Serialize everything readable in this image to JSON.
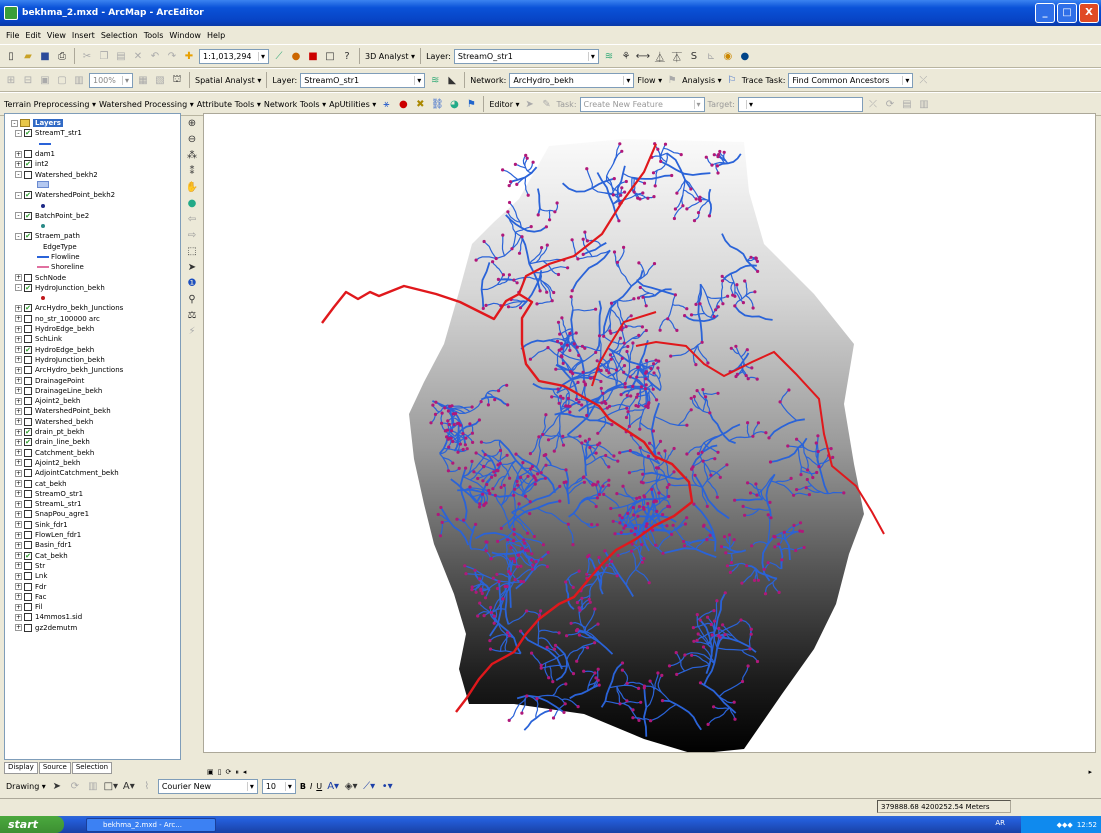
{
  "window": {
    "title": "bekhma_2.mxd - ArcMap - ArcEditor",
    "buttons": [
      "_",
      "□",
      "X"
    ]
  },
  "menu": [
    "File",
    "Edit",
    "View",
    "Insert",
    "Selection",
    "Tools",
    "Window",
    "Help"
  ],
  "standard_tb": {
    "scale": "1:1,013,294",
    "analyst_3d": "3D Analyst ▾",
    "layer_label": "Layer:",
    "layer_value": "StreamO_str1"
  },
  "spatial_tb": {
    "zoom": "100%",
    "spatial_analyst": "Spatial Analyst ▾",
    "layer_label": "Layer:",
    "layer_value": "StreamO_str1",
    "network_label": "Network:",
    "network_value": "ArcHydro_bekh",
    "flow": "Flow ▾",
    "analysis": "Analysis ▾",
    "trace_label": "Trace Task:",
    "trace_value": "Find Common Ancestors"
  },
  "hydro_tb": {
    "items": [
      "Terrain Preprocessing ▾",
      "Watershed Processing ▾",
      "Attribute Tools ▾",
      "Network Tools ▾",
      "ApUtilities ▾"
    ],
    "editor": "Editor ▾",
    "task_label": "Task:",
    "task_value": "Create New Feature",
    "target_label": "Target:"
  },
  "toc": {
    "rows": [
      {
        "type": "group",
        "exp": "-",
        "label": "Layers"
      },
      {
        "type": "layer",
        "exp": "-",
        "checked": true,
        "label": "StreamT_str1"
      },
      {
        "type": "sym",
        "symbol": "line-blue"
      },
      {
        "type": "layer",
        "exp": "+",
        "checked": false,
        "label": "dam1"
      },
      {
        "type": "layer",
        "exp": "+",
        "checked": true,
        "label": "int2"
      },
      {
        "type": "layer",
        "exp": "-",
        "checked": false,
        "label": "Watershed_bekh2"
      },
      {
        "type": "sym",
        "symbol": "poly-blue"
      },
      {
        "type": "layer",
        "exp": "-",
        "checked": true,
        "label": "WatershedPoint_bekh2"
      },
      {
        "type": "sym",
        "symbol": "dot-navy"
      },
      {
        "type": "layer",
        "exp": "-",
        "checked": true,
        "label": "BatchPoint_be2"
      },
      {
        "type": "sym",
        "symbol": "dot-teal"
      },
      {
        "type": "layer",
        "exp": "-",
        "checked": true,
        "label": "Straem_path"
      },
      {
        "type": "text",
        "label": "EdgeType"
      },
      {
        "type": "legend",
        "symbol": "line-blue",
        "label": "Flowline"
      },
      {
        "type": "legend",
        "symbol": "line-pink",
        "label": "Shoreline"
      },
      {
        "type": "layer",
        "exp": "+",
        "checked": false,
        "label": "SchNode"
      },
      {
        "type": "layer",
        "exp": "-",
        "checked": true,
        "label": "HydroJunction_bekh"
      },
      {
        "type": "sym",
        "symbol": "dot-red"
      },
      {
        "type": "layer",
        "exp": "+",
        "checked": true,
        "label": "ArcHydro_bekh_Junctions"
      },
      {
        "type": "layer",
        "exp": "+",
        "checked": false,
        "label": "no_str_100000 arc"
      },
      {
        "type": "layer",
        "exp": "+",
        "checked": false,
        "label": "HydroEdge_bekh"
      },
      {
        "type": "layer",
        "exp": "+",
        "checked": false,
        "label": "SchLink"
      },
      {
        "type": "layer",
        "exp": "+",
        "checked": true,
        "label": "HydroEdge_bekh"
      },
      {
        "type": "layer",
        "exp": "+",
        "checked": false,
        "label": "HydroJunction_bekh"
      },
      {
        "type": "layer",
        "exp": "+",
        "checked": false,
        "label": "ArcHydro_bekh_Junctions"
      },
      {
        "type": "layer",
        "exp": "+",
        "checked": false,
        "label": "DrainagePoint"
      },
      {
        "type": "layer",
        "exp": "+",
        "checked": false,
        "label": "DrainageLine_bekh"
      },
      {
        "type": "layer",
        "exp": "+",
        "checked": false,
        "label": "Ajoint2_bekh"
      },
      {
        "type": "layer",
        "exp": "+",
        "checked": false,
        "label": "WatershedPoint_bekh"
      },
      {
        "type": "layer",
        "exp": "+",
        "checked": false,
        "label": "Watershed_bekh"
      },
      {
        "type": "layer",
        "exp": "+",
        "checked": true,
        "label": "drain_pt_bekh"
      },
      {
        "type": "layer",
        "exp": "+",
        "checked": true,
        "label": "drain_line_bekh"
      },
      {
        "type": "layer",
        "exp": "+",
        "checked": false,
        "label": "Catchment_bekh"
      },
      {
        "type": "layer",
        "exp": "+",
        "checked": false,
        "label": "Ajoint2_bekh"
      },
      {
        "type": "layer",
        "exp": "+",
        "checked": false,
        "label": "AdjointCatchment_bekh"
      },
      {
        "type": "layer",
        "exp": "+",
        "checked": false,
        "label": "cat_bekh"
      },
      {
        "type": "layer",
        "exp": "+",
        "checked": false,
        "label": "StreamO_str1"
      },
      {
        "type": "layer",
        "exp": "+",
        "checked": false,
        "label": "StreamL_str1"
      },
      {
        "type": "layer",
        "exp": "+",
        "checked": false,
        "label": "SnapPou_agre1"
      },
      {
        "type": "layer",
        "exp": "+",
        "checked": false,
        "label": "Sink_fdr1"
      },
      {
        "type": "layer",
        "exp": "+",
        "checked": false,
        "label": "FlowLen_fdr1"
      },
      {
        "type": "layer",
        "exp": "+",
        "checked": false,
        "label": "Basin_fdr1"
      },
      {
        "type": "layer",
        "exp": "+",
        "checked": true,
        "label": "Cat_bekh"
      },
      {
        "type": "layer",
        "exp": "+",
        "checked": false,
        "label": "Str"
      },
      {
        "type": "layer",
        "exp": "+",
        "checked": false,
        "label": "Lnk"
      },
      {
        "type": "layer",
        "exp": "+",
        "checked": false,
        "label": "Fdr"
      },
      {
        "type": "layer",
        "exp": "+",
        "checked": false,
        "label": "Fac"
      },
      {
        "type": "layer",
        "exp": "+",
        "checked": false,
        "label": "Fil"
      },
      {
        "type": "layer",
        "exp": "+",
        "checked": false,
        "label": "14mmos1.sid"
      },
      {
        "type": "layer",
        "exp": "+",
        "checked": false,
        "label": "gz2demutm"
      }
    ]
  },
  "tabs": {
    "display": "Display",
    "source": "Source",
    "selection": "Selection"
  },
  "drawing_tb": {
    "drawing": "Drawing ▾",
    "font": "Courier New",
    "size": "10",
    "bold": "B",
    "italic": "I",
    "underline": "U"
  },
  "status": {
    "coords": "379888.68  4200252.54 Meters"
  },
  "taskbar": {
    "start": "start",
    "item": "bekhma_2.mxd - Arc...",
    "lang": "AR",
    "clock": "12:52"
  },
  "colors": {
    "main_stream": "#e0181c",
    "tributary": "#2a63d8",
    "junction": "#b0187a",
    "titlebar": "#0a52d8",
    "face": "#ece9d8"
  }
}
